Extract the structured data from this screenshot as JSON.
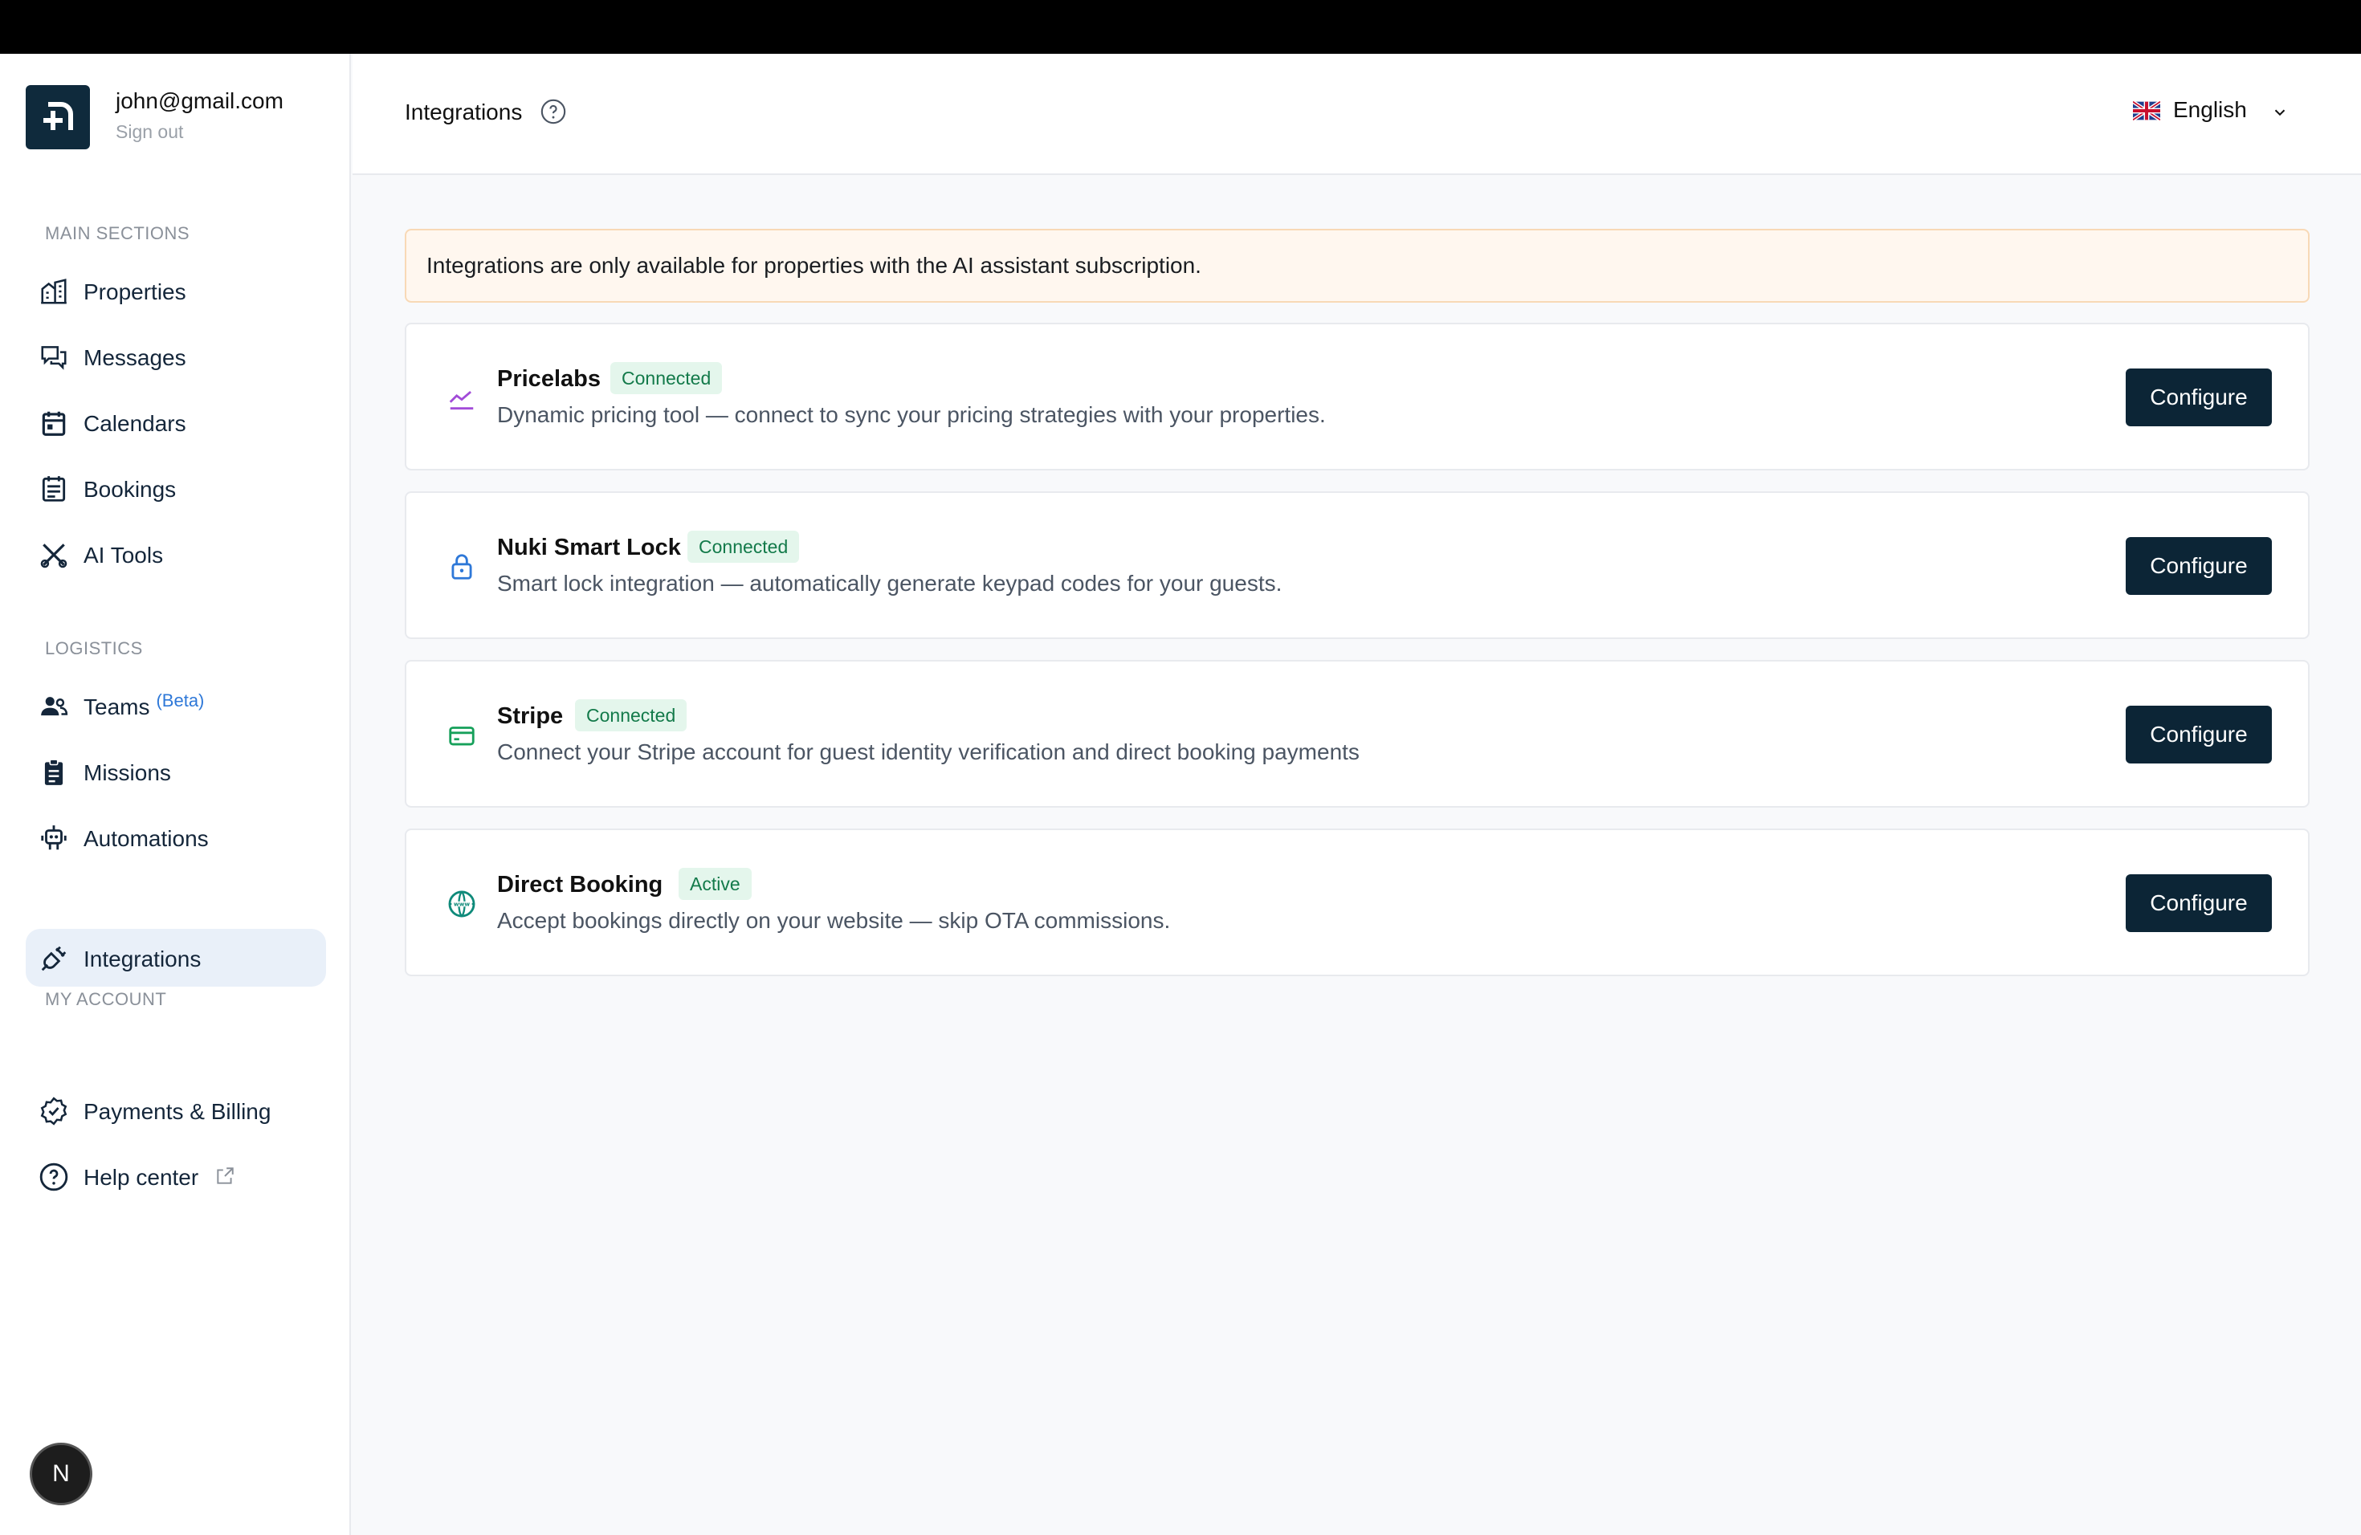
{
  "user": {
    "email": "john@gmail.com",
    "sign_out": "Sign out"
  },
  "sidebar": {
    "sections": [
      {
        "title": "MAIN SECTIONS",
        "items": [
          {
            "label": "Properties",
            "icon": "building-icon"
          },
          {
            "label": "Messages",
            "icon": "chat-icon"
          },
          {
            "label": "Calendars",
            "icon": "calendar-icon"
          },
          {
            "label": "Bookings",
            "icon": "list-icon"
          },
          {
            "label": "AI Tools",
            "icon": "tools-icon"
          }
        ]
      },
      {
        "title": "LOGISTICS",
        "items": [
          {
            "label": "Teams",
            "badge": "(Beta)",
            "icon": "users-icon"
          },
          {
            "label": "Missions",
            "icon": "clipboard-icon"
          },
          {
            "label": "Automations",
            "icon": "robot-icon"
          },
          {
            "label": "Integrations",
            "icon": "plug-icon",
            "active": true
          }
        ]
      },
      {
        "title": "MY ACCOUNT",
        "items": [
          {
            "label": "Payments & Billing",
            "icon": "badge-check-icon"
          },
          {
            "label": "Help center",
            "icon": "help-circle-icon"
          }
        ]
      }
    ]
  },
  "header": {
    "title": "Integrations",
    "language": "English"
  },
  "notice": "Integrations are only available for properties with the AI assistant subscription.",
  "integrations": [
    {
      "name": "Pricelabs",
      "status": "Connected",
      "icon": "chart-line-icon",
      "description": "Dynamic pricing tool — connect to sync your pricing strategies with your properties.",
      "button": "Configure"
    },
    {
      "name": "Nuki Smart Lock",
      "status": "Connected",
      "icon": "lock-icon",
      "description": "Smart lock integration — automatically generate keypad codes for your guests.",
      "button": "Configure"
    },
    {
      "name": "Stripe",
      "status": "Connected",
      "icon": "credit-card-icon",
      "description": "Connect your Stripe account for guest identity verification and direct booking payments",
      "button": "Configure"
    },
    {
      "name": "Direct Booking",
      "status": "Active",
      "icon": "globe-www-icon",
      "description": "Accept bookings directly on your website — skip OTA commissions.",
      "button": "Configure"
    }
  ],
  "colors": {
    "primary_button": "#0c2536",
    "active_nav_bg": "#e9f0f9",
    "badge_text": "#137a4a",
    "badge_bg": "#e4f6ec",
    "notice_bg": "#fff7ef",
    "notice_border": "#f8d9b6"
  },
  "dev_badge": "N"
}
